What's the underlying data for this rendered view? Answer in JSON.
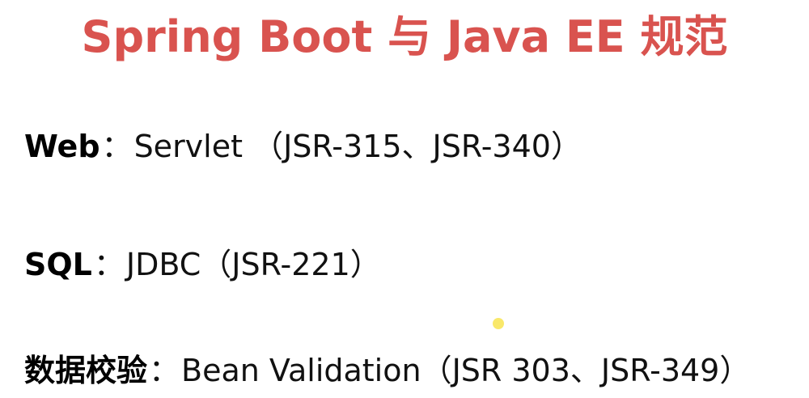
{
  "slide": {
    "title": "Spring Boot 与 Java EE 规范",
    "title_color": "#d9534f",
    "items": [
      {
        "term": "Web",
        "separator": "：",
        "description": "Servlet （JSR-315、JSR-340）"
      },
      {
        "term": "SQL",
        "separator": "：",
        "description": "JDBC（JSR-221）"
      },
      {
        "term": "数据校验",
        "separator": "：",
        "description": "Bean Validation（JSR 303、JSR-349）"
      }
    ],
    "cursor_color": "#f9e86a"
  }
}
